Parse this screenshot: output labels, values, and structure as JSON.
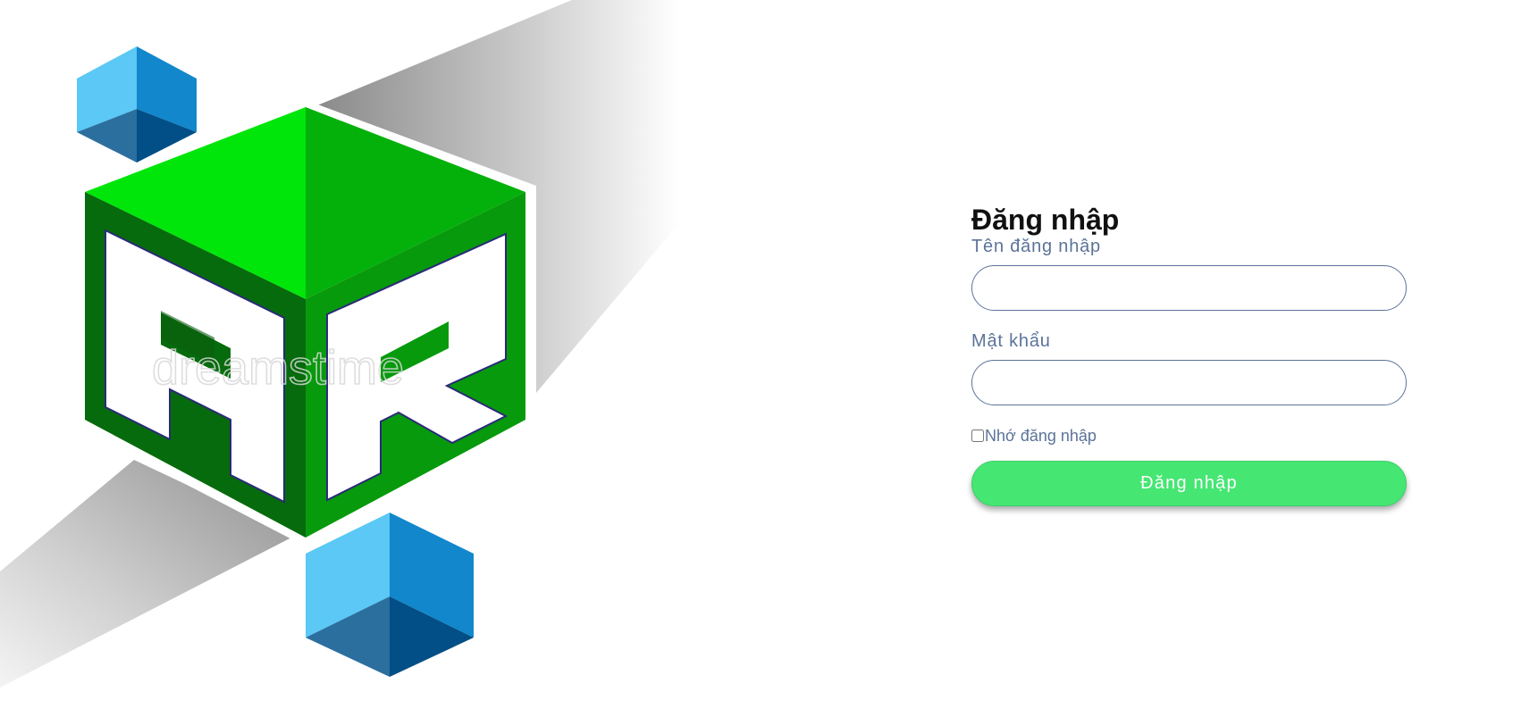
{
  "login": {
    "title": "Đăng nhập",
    "username_label": "Tên đăng nhập",
    "username_value": "",
    "password_label": "Mật khẩu",
    "password_value": "",
    "remember_label": "Nhớ đăng nhập",
    "remember_checked": false,
    "submit_label": "Đăng nhập"
  },
  "logo": {
    "letters": "AR",
    "watermark": "dreamstime"
  },
  "colors": {
    "label_text": "#5b7399",
    "field_border": "#5b7399",
    "button_bg": "#45e672",
    "logo_green_light": "#00e60a",
    "logo_green_mid": "#04b10b",
    "logo_green_dark": "#066b0c",
    "cube_blue_light": "#5bc8f5",
    "cube_blue_mid": "#1287cb",
    "cube_blue_dark": "#014f86"
  }
}
